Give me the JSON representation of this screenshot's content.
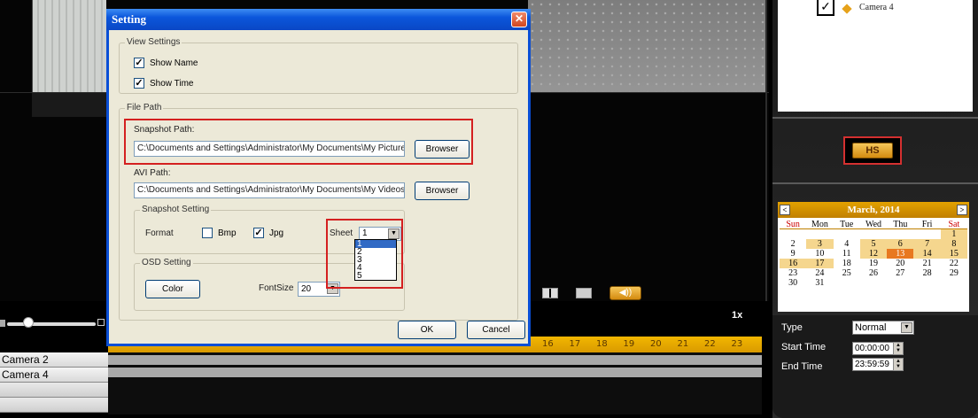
{
  "background": {
    "speed_label": "1x",
    "audio_button": "◀))",
    "timeline_ticks": [
      "16",
      "17",
      "18",
      "19",
      "20",
      "21",
      "22",
      "23"
    ],
    "cameras": [
      "Camera 2",
      "Camera 4"
    ],
    "camera_list_item": "Camera 4",
    "backup_button": "HS",
    "calendar": {
      "title": "March, 2014",
      "prev": "<",
      "next": ">",
      "weekdays": [
        "Sun",
        "Mon",
        "Tue",
        "Wed",
        "Thu",
        "Fri",
        "Sat"
      ],
      "weeks": [
        [
          "",
          "",
          "",
          "",
          "",
          "",
          "1"
        ],
        [
          "2",
          "3",
          "4",
          "5",
          "6",
          "7",
          "8"
        ],
        [
          "9",
          "10",
          "11",
          "12",
          "13",
          "14",
          "15"
        ],
        [
          "16",
          "17",
          "18",
          "19",
          "20",
          "21",
          "22"
        ],
        [
          "23",
          "24",
          "25",
          "26",
          "27",
          "28",
          "29"
        ],
        [
          "30",
          "31",
          "",
          "",
          "",
          "",
          ""
        ]
      ],
      "selected_day": "13",
      "highlighted_days": [
        "1",
        "3",
        "5",
        "6",
        "7",
        "8",
        "12",
        "14",
        "15",
        "16",
        "17"
      ]
    },
    "search": {
      "type_label": "Type",
      "type_value": "Normal",
      "start_label": "Start Time",
      "start_value": "00:00:00",
      "end_label": "End Time",
      "end_value": "23:59:59"
    }
  },
  "dialog": {
    "title": "Setting",
    "close": "✕",
    "view_settings": {
      "title": "View Settings",
      "show_name": "Show Name",
      "show_name_checked": true,
      "show_time": "Show Time",
      "show_time_checked": true
    },
    "file_path": {
      "title": "File Path",
      "snapshot_label": "Snapshot Path:",
      "snapshot_value": "C:\\Documents and Settings\\Administrator\\My Documents\\My Pictures",
      "avi_label": "AVI Path:",
      "avi_value": "C:\\Documents and Settings\\Administrator\\My Documents\\My Videos",
      "browse_label": "Browser"
    },
    "snapshot_setting": {
      "title": "Snapshot Setting",
      "format_label": "Format",
      "bmp_label": "Bmp",
      "bmp_checked": false,
      "jpg_label": "Jpg",
      "jpg_checked": true,
      "sheet_label": "Sheet",
      "sheet_value": "1",
      "sheet_options": [
        "1",
        "2",
        "3",
        "4",
        "5"
      ]
    },
    "osd_setting": {
      "title": "OSD Setting",
      "color_button": "Color",
      "fontsize_label": "FontSize",
      "fontsize_value": "20"
    },
    "ok_label": "OK",
    "cancel_label": "Cancel"
  },
  "colors": {
    "titlebar": "#0b56db",
    "highlight_red": "#d42020",
    "accent_gold": "#e3a200"
  }
}
